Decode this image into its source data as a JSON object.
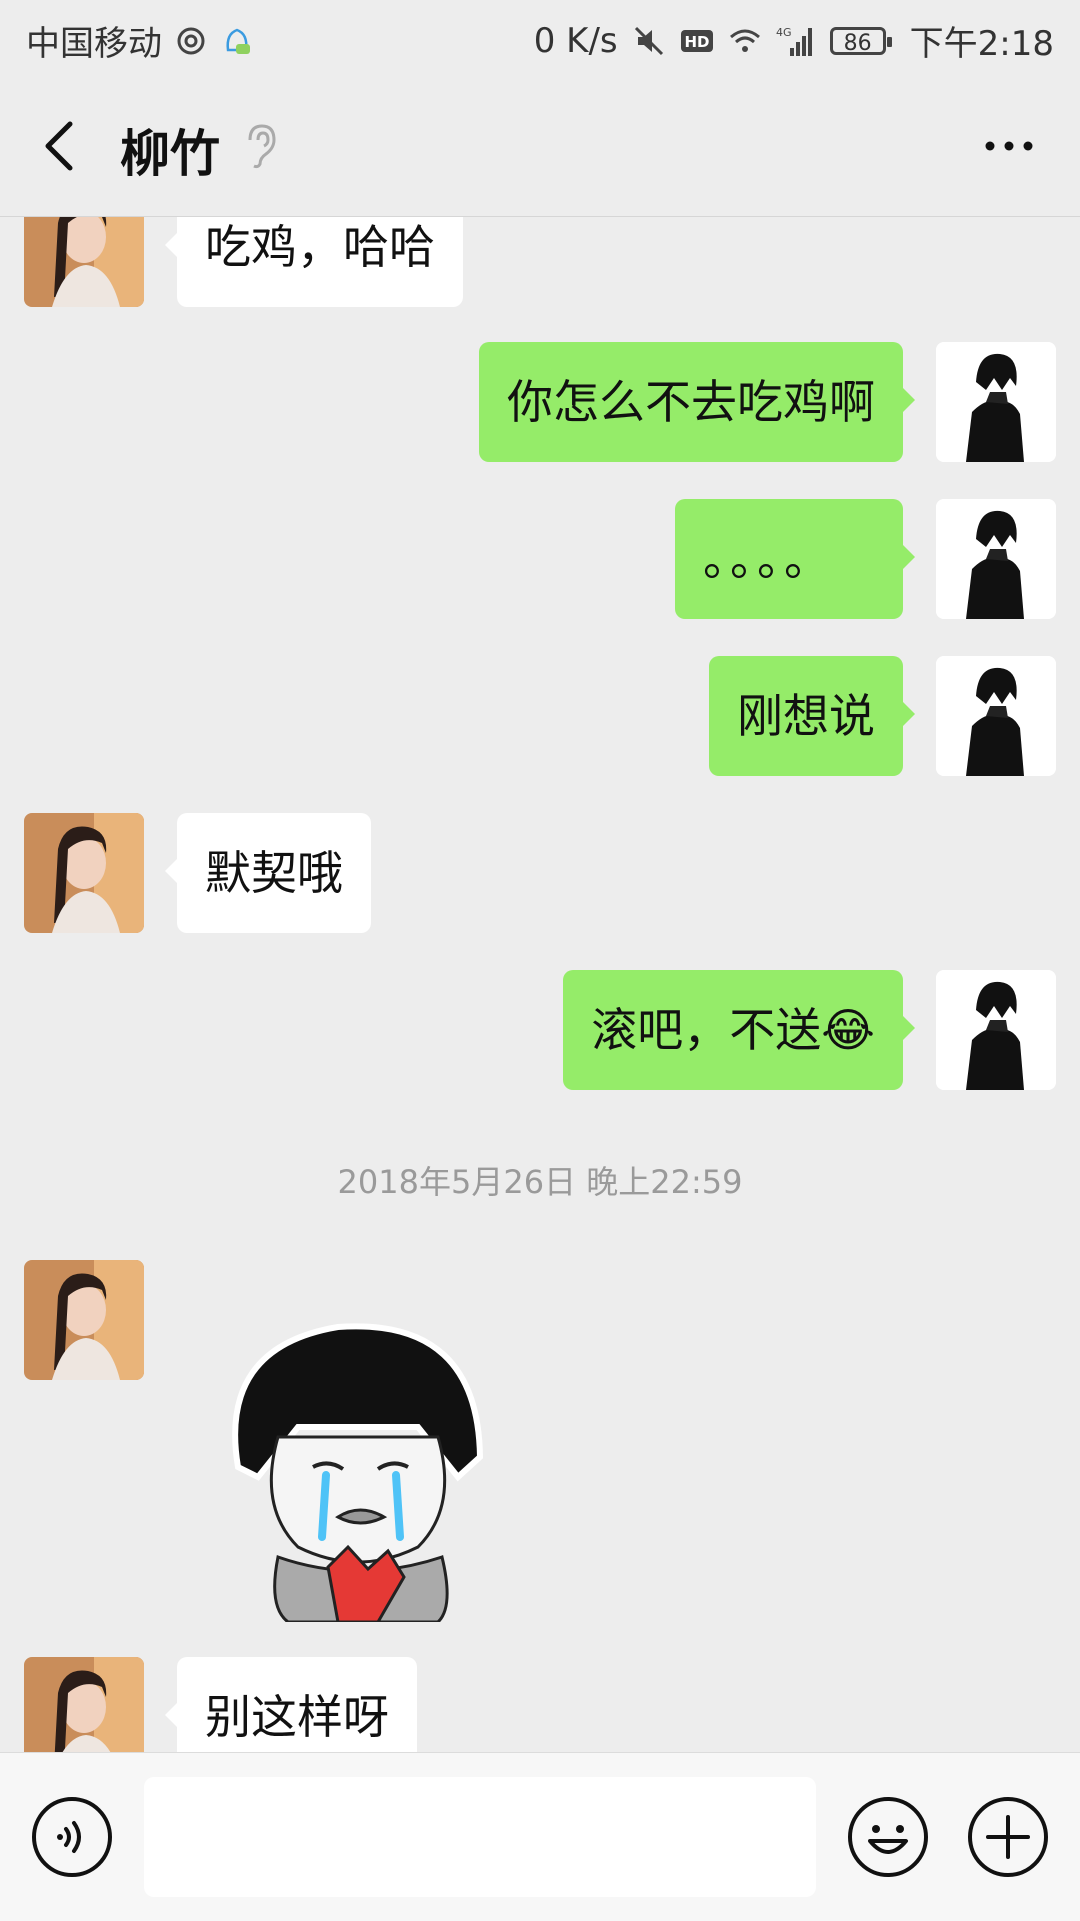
{
  "status_bar": {
    "carrier": "中国移动",
    "speed": "0 K/s",
    "network": "4G",
    "battery": "86",
    "time": "下午2:18"
  },
  "header": {
    "title": "柳竹"
  },
  "messages": [
    {
      "side": "left",
      "text": "吃鸡，哈哈"
    },
    {
      "side": "right",
      "text": "你怎么不去吃鸡啊"
    },
    {
      "side": "right",
      "text": "。。。。"
    },
    {
      "side": "right",
      "text": "刚想说"
    },
    {
      "side": "left",
      "text": "默契哦"
    },
    {
      "side": "right",
      "text": "滚吧，不送",
      "emoji": "😂"
    },
    {
      "side": "left",
      "text": "别这样呀"
    }
  ],
  "timestamp": "2018年5月26日 晚上22:59",
  "icons": {
    "back": "back-arrow-icon",
    "ear": "earpiece-mode-icon",
    "more": "more-dots-icon",
    "voice": "voice-input-icon",
    "emoji": "emoji-icon",
    "plus": "add-icon"
  },
  "colors": {
    "background": "#ededed",
    "outgoing_bubble": "#95ec69",
    "incoming_bubble": "#ffffff"
  }
}
